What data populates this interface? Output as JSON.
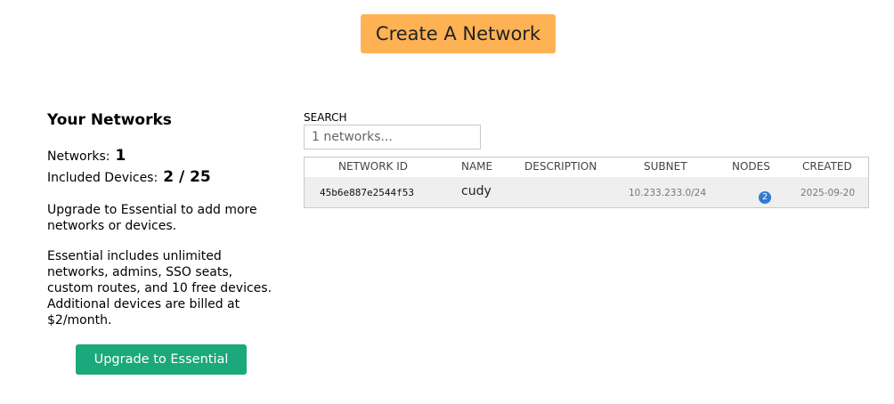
{
  "header": {
    "create_label": "Create A Network"
  },
  "sidebar": {
    "title": "Your Networks",
    "networks_label": "Networks:",
    "networks_value": "1",
    "devices_label": "Included Devices:",
    "devices_value": "2 / 25",
    "upgrade_text": "Upgrade to Essential to add more networks or devices.",
    "essential_text": "Essential includes unlimited networks, admins, SSO seats, custom routes, and 10 free devices. Additional devices are billed at $2/month.",
    "upgrade_button": "Upgrade to Essential"
  },
  "search": {
    "label": "SEARCH",
    "placeholder": "1 networks...",
    "value": ""
  },
  "table": {
    "columns": [
      "NETWORK ID",
      "NAME",
      "DESCRIPTION",
      "SUBNET",
      "NODES",
      "CREATED"
    ],
    "rows": [
      {
        "id": "45b6e887e2544f53",
        "name": "cudy",
        "description": "",
        "subnet": "10.233.233.0/24",
        "nodes": "2",
        "created": "2025-09-20"
      }
    ]
  },
  "colors": {
    "create_button": "#ffb254",
    "upgrade_button": "#1ba87a",
    "badge": "#2f7bd6"
  }
}
